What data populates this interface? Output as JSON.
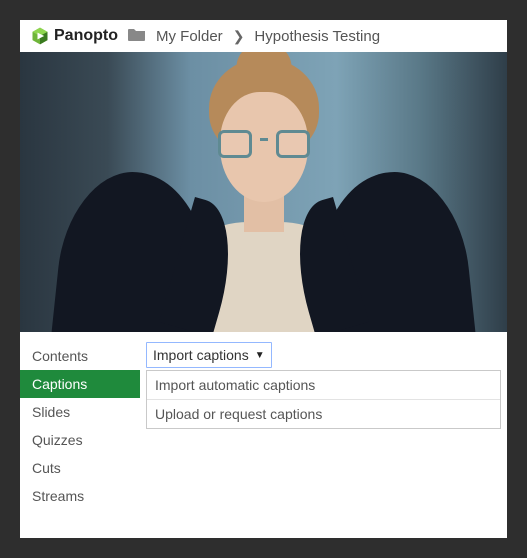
{
  "brand": {
    "name": "Panopto"
  },
  "breadcrumb": {
    "folder": "My Folder",
    "page": "Hypothesis Testing"
  },
  "sidebar": {
    "items": [
      {
        "label": "Contents",
        "active": false
      },
      {
        "label": "Captions",
        "active": true
      },
      {
        "label": "Slides",
        "active": false
      },
      {
        "label": "Quizzes",
        "active": false
      },
      {
        "label": "Cuts",
        "active": false
      },
      {
        "label": "Streams",
        "active": false
      }
    ]
  },
  "captions": {
    "dropdown_label": "Import captions",
    "options": [
      "Import automatic captions",
      "Upload or request captions"
    ]
  },
  "colors": {
    "accent": "#1f8a3c",
    "focus_border": "#94b8ff"
  }
}
